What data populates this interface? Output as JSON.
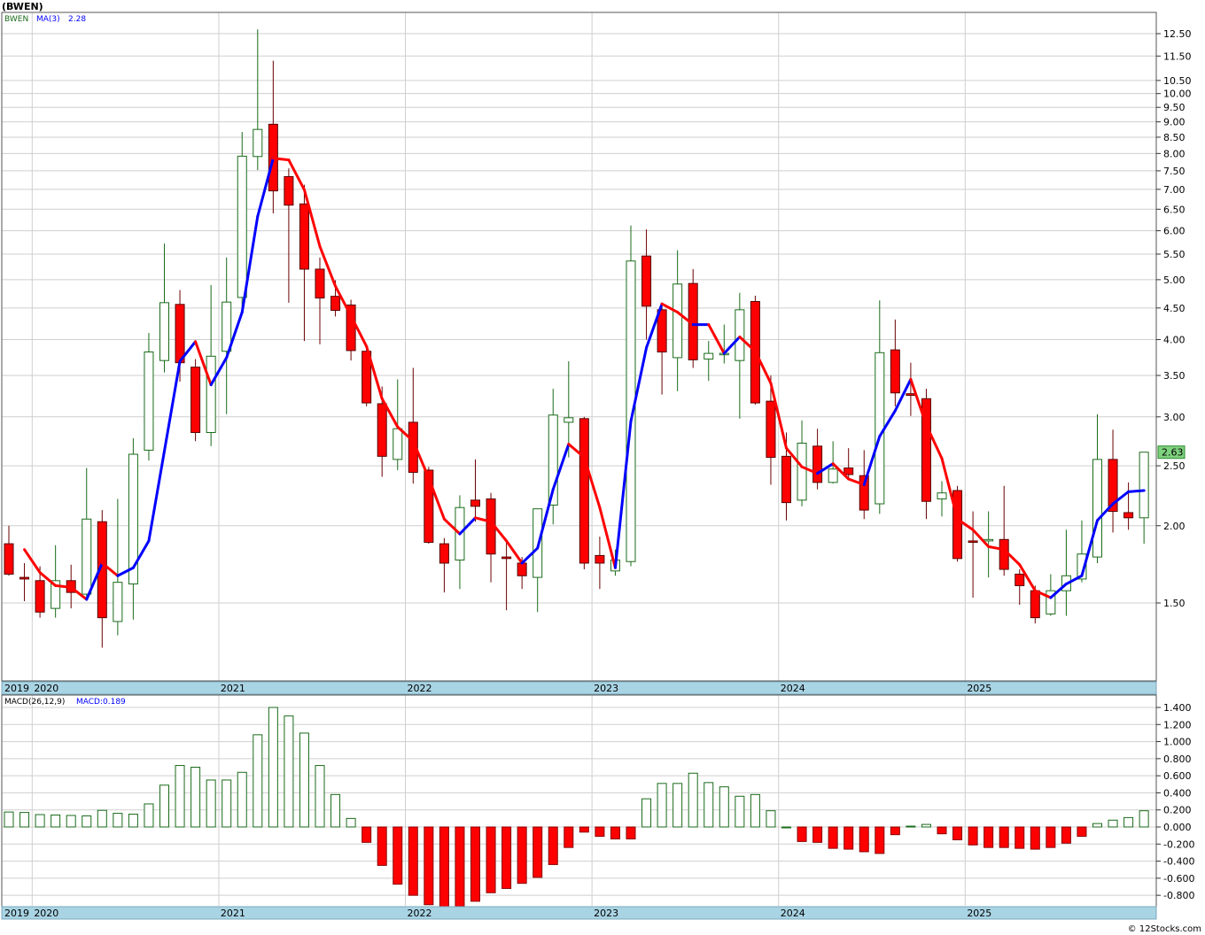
{
  "header": {
    "title": "(BWEN)",
    "watermark": "© 12Stocks.com"
  },
  "price_legend": {
    "symbol": "BWEN",
    "ma_label": "MA(3)",
    "ma_value": "2.28",
    "last_price": "2.63"
  },
  "macd_legend": {
    "label": "MACD(26,12,9)",
    "value": "MACD:0.189"
  },
  "colors": {
    "up": "#1a6b1a",
    "down": "#ff0000",
    "ma_up": "#0000ff",
    "ma_down": "#ff0000",
    "grid": "#cfcfcf",
    "axis_band": "#a9d4e4",
    "last_badge": "#7ed27e"
  },
  "chart_data": [
    {
      "type": "candlestick",
      "scale": "log",
      "interval": "monthly",
      "title": "(BWEN)",
      "x_labels": [
        "2019",
        "2020",
        "2021",
        "2022",
        "2023",
        "2024",
        "2025"
      ],
      "y_ticks": [
        "12.50",
        "11.50",
        "10.50",
        "10.00",
        "9.50",
        "9.00",
        "8.50",
        "8.00",
        "7.50",
        "7.00",
        "6.50",
        "6.00",
        "5.50",
        "5.00",
        "4.50",
        "4.00",
        "3.50",
        "3.00",
        "2.50",
        "2.00",
        "1.50"
      ],
      "grid": true,
      "candles": [
        {
          "d": "2019-11",
          "o": 1.87,
          "h": 2.0,
          "l": 1.66,
          "c": 1.67
        },
        {
          "d": "2019-12",
          "o": 1.65,
          "h": 1.74,
          "l": 1.51,
          "c": 1.64
        },
        {
          "d": "2020-01",
          "o": 1.63,
          "h": 1.72,
          "l": 1.42,
          "c": 1.45
        },
        {
          "d": "2020-02",
          "o": 1.47,
          "h": 1.86,
          "l": 1.42,
          "c": 1.63
        },
        {
          "d": "2020-03",
          "o": 1.63,
          "h": 1.73,
          "l": 1.47,
          "c": 1.56
        },
        {
          "d": "2020-04",
          "o": 1.55,
          "h": 2.48,
          "l": 1.52,
          "c": 2.05
        },
        {
          "d": "2020-05",
          "o": 2.03,
          "h": 2.12,
          "l": 1.27,
          "c": 1.42
        },
        {
          "d": "2020-06",
          "o": 1.4,
          "h": 2.21,
          "l": 1.33,
          "c": 1.62
        },
        {
          "d": "2020-07",
          "o": 1.61,
          "h": 2.77,
          "l": 1.41,
          "c": 2.61
        },
        {
          "d": "2020-08",
          "o": 2.65,
          "h": 4.1,
          "l": 2.55,
          "c": 3.82
        },
        {
          "d": "2020-09",
          "o": 3.7,
          "h": 5.72,
          "l": 3.54,
          "c": 4.59
        },
        {
          "d": "2020-10",
          "o": 4.56,
          "h": 4.81,
          "l": 3.42,
          "c": 3.67
        },
        {
          "d": "2020-11",
          "o": 3.61,
          "h": 3.72,
          "l": 2.74,
          "c": 2.83
        },
        {
          "d": "2020-12",
          "o": 2.83,
          "h": 4.9,
          "l": 2.69,
          "c": 3.76
        },
        {
          "d": "2021-01",
          "o": 3.83,
          "h": 5.43,
          "l": 3.03,
          "c": 4.6
        },
        {
          "d": "2021-02",
          "o": 4.68,
          "h": 8.67,
          "l": 4.43,
          "c": 7.92
        },
        {
          "d": "2021-03",
          "o": 7.91,
          "h": 12.7,
          "l": 7.52,
          "c": 8.75
        },
        {
          "d": "2021-04",
          "o": 8.92,
          "h": 11.3,
          "l": 6.4,
          "c": 6.96
        },
        {
          "d": "2021-05",
          "o": 7.34,
          "h": 7.57,
          "l": 4.59,
          "c": 6.6
        },
        {
          "d": "2021-06",
          "o": 6.63,
          "h": 7.12,
          "l": 3.98,
          "c": 5.2
        },
        {
          "d": "2021-07",
          "o": 5.2,
          "h": 5.43,
          "l": 3.93,
          "c": 4.67
        },
        {
          "d": "2021-08",
          "o": 4.7,
          "h": 4.99,
          "l": 4.36,
          "c": 4.46
        },
        {
          "d": "2021-09",
          "o": 4.55,
          "h": 4.64,
          "l": 3.7,
          "c": 3.84
        },
        {
          "d": "2021-10",
          "o": 3.83,
          "h": 3.89,
          "l": 3.12,
          "c": 3.16
        },
        {
          "d": "2021-11",
          "o": 3.15,
          "h": 3.36,
          "l": 2.4,
          "c": 2.59
        },
        {
          "d": "2021-12",
          "o": 2.56,
          "h": 3.45,
          "l": 2.46,
          "c": 2.87
        },
        {
          "d": "2022-01",
          "o": 2.94,
          "h": 3.6,
          "l": 2.34,
          "c": 2.44
        },
        {
          "d": "2022-02",
          "o": 2.46,
          "h": 2.49,
          "l": 1.87,
          "c": 1.88
        },
        {
          "d": "2022-03",
          "o": 1.87,
          "h": 1.91,
          "l": 1.56,
          "c": 1.74
        },
        {
          "d": "2022-04",
          "o": 1.76,
          "h": 2.24,
          "l": 1.58,
          "c": 2.14
        },
        {
          "d": "2022-05",
          "o": 2.2,
          "h": 2.56,
          "l": 2.03,
          "c": 2.15
        },
        {
          "d": "2022-06",
          "o": 2.21,
          "h": 2.26,
          "l": 1.62,
          "c": 1.8
        },
        {
          "d": "2022-07",
          "o": 1.78,
          "h": 1.88,
          "l": 1.46,
          "c": 1.77
        },
        {
          "d": "2022-08",
          "o": 1.74,
          "h": 1.78,
          "l": 1.58,
          "c": 1.66
        },
        {
          "d": "2022-09",
          "o": 1.65,
          "h": 2.11,
          "l": 1.45,
          "c": 2.13
        },
        {
          "d": "2022-10",
          "o": 2.16,
          "h": 3.33,
          "l": 2.01,
          "c": 3.02
        },
        {
          "d": "2022-11",
          "o": 2.94,
          "h": 3.69,
          "l": 2.58,
          "c": 2.99
        },
        {
          "d": "2022-12",
          "o": 2.98,
          "h": 3.0,
          "l": 1.7,
          "c": 1.74
        },
        {
          "d": "2023-01",
          "o": 1.79,
          "h": 1.92,
          "l": 1.58,
          "c": 1.74
        },
        {
          "d": "2023-02",
          "o": 1.69,
          "h": 1.83,
          "l": 1.66,
          "c": 1.76
        },
        {
          "d": "2023-03",
          "o": 1.75,
          "h": 6.12,
          "l": 1.72,
          "c": 5.36
        },
        {
          "d": "2023-04",
          "o": 5.46,
          "h": 6.03,
          "l": 4.0,
          "c": 4.53
        },
        {
          "d": "2023-05",
          "o": 4.47,
          "h": 4.55,
          "l": 3.26,
          "c": 3.82
        },
        {
          "d": "2023-06",
          "o": 3.74,
          "h": 5.58,
          "l": 3.3,
          "c": 4.92
        },
        {
          "d": "2023-07",
          "o": 4.93,
          "h": 5.2,
          "l": 3.6,
          "c": 3.71
        },
        {
          "d": "2023-08",
          "o": 3.72,
          "h": 3.98,
          "l": 3.43,
          "c": 3.8
        },
        {
          "d": "2023-09",
          "o": 3.78,
          "h": 4.23,
          "l": 3.66,
          "c": 3.8
        },
        {
          "d": "2023-10",
          "o": 3.7,
          "h": 4.76,
          "l": 2.98,
          "c": 4.47
        },
        {
          "d": "2023-11",
          "o": 4.61,
          "h": 4.71,
          "l": 3.14,
          "c": 3.16
        },
        {
          "d": "2023-12",
          "o": 3.18,
          "h": 3.5,
          "l": 2.33,
          "c": 2.58
        },
        {
          "d": "2024-01",
          "o": 2.59,
          "h": 2.83,
          "l": 2.04,
          "c": 2.18
        },
        {
          "d": "2024-02",
          "o": 2.2,
          "h": 2.96,
          "l": 2.15,
          "c": 2.72
        },
        {
          "d": "2024-03",
          "o": 2.69,
          "h": 2.87,
          "l": 2.29,
          "c": 2.35
        },
        {
          "d": "2024-04",
          "o": 2.35,
          "h": 2.74,
          "l": 2.34,
          "c": 2.47
        },
        {
          "d": "2024-05",
          "o": 2.48,
          "h": 2.67,
          "l": 2.37,
          "c": 2.42
        },
        {
          "d": "2024-06",
          "o": 2.41,
          "h": 2.65,
          "l": 2.05,
          "c": 2.12
        },
        {
          "d": "2024-07",
          "o": 2.17,
          "h": 4.63,
          "l": 2.09,
          "c": 3.81
        },
        {
          "d": "2024-08",
          "o": 3.85,
          "h": 4.31,
          "l": 3.12,
          "c": 3.28
        },
        {
          "d": "2024-09",
          "o": 3.27,
          "h": 3.67,
          "l": 3.01,
          "c": 3.25
        },
        {
          "d": "2024-10",
          "o": 3.21,
          "h": 3.33,
          "l": 2.05,
          "c": 2.19
        },
        {
          "d": "2024-11",
          "o": 2.21,
          "h": 2.36,
          "l": 2.07,
          "c": 2.26
        },
        {
          "d": "2024-12",
          "o": 2.28,
          "h": 2.32,
          "l": 1.75,
          "c": 1.77
        },
        {
          "d": "2025-01",
          "o": 1.89,
          "h": 2.11,
          "l": 1.53,
          "c": 1.88
        },
        {
          "d": "2025-02",
          "o": 1.89,
          "h": 2.11,
          "l": 1.65,
          "c": 1.9
        },
        {
          "d": "2025-03",
          "o": 1.9,
          "h": 2.32,
          "l": 1.66,
          "c": 1.7
        },
        {
          "d": "2025-04",
          "o": 1.67,
          "h": 1.7,
          "l": 1.49,
          "c": 1.6
        },
        {
          "d": "2025-05",
          "o": 1.57,
          "h": 1.6,
          "l": 1.39,
          "c": 1.42
        },
        {
          "d": "2025-06",
          "o": 1.44,
          "h": 1.67,
          "l": 1.43,
          "c": 1.57
        },
        {
          "d": "2025-07",
          "o": 1.57,
          "h": 1.97,
          "l": 1.43,
          "c": 1.66
        },
        {
          "d": "2025-08",
          "o": 1.64,
          "h": 2.04,
          "l": 1.62,
          "c": 1.8
        },
        {
          "d": "2025-09",
          "o": 1.78,
          "h": 3.03,
          "l": 1.74,
          "c": 2.56
        },
        {
          "d": "2025-10",
          "o": 2.56,
          "h": 2.86,
          "l": 1.95,
          "c": 2.11
        },
        {
          "d": "2025-11",
          "o": 2.1,
          "h": 2.35,
          "l": 1.97,
          "c": 2.06
        },
        {
          "d": "2025-12",
          "o": 2.06,
          "h": 2.63,
          "l": 1.87,
          "c": 2.63
        }
      ],
      "series": [
        {
          "name": "MA(3)",
          "values": [
            null,
            1.83,
            1.68,
            1.6,
            1.59,
            1.52,
            1.74,
            1.66,
            1.71,
            1.89,
            2.64,
            3.69,
            3.97,
            3.38,
            3.74,
            4.43,
            6.33,
            7.86,
            7.81,
            6.99,
            5.66,
            4.88,
            4.37,
            3.9,
            3.21,
            2.89,
            2.74,
            2.39,
            2.05,
            1.94,
            2.06,
            2.03,
            1.89,
            1.74,
            1.84,
            2.29,
            2.71,
            2.58,
            2.14,
            1.71,
            2.95,
            3.88,
            4.57,
            4.43,
            4.23,
            4.23,
            3.8,
            4.04,
            3.83,
            3.4,
            2.67,
            2.49,
            2.43,
            2.52,
            2.38,
            2.33,
            2.79,
            3.07,
            3.45,
            2.91,
            2.57,
            2.05,
            1.97,
            1.85,
            1.83,
            1.73,
            1.57,
            1.53,
            1.61,
            1.66,
            2.04,
            2.17,
            2.27,
            2.28
          ]
        }
      ]
    },
    {
      "type": "bar",
      "title": "MACD(26,12,9)",
      "x_labels": [
        "2019",
        "2020",
        "2021",
        "2022",
        "2023",
        "2024",
        "2025"
      ],
      "y_ticks": [
        "1.400",
        "1.200",
        "1.000",
        "0.800",
        "0.600",
        "0.400",
        "0.200",
        "0.000",
        "-0.200",
        "-0.400",
        "-0.600",
        "-0.800"
      ],
      "ylim": [
        -0.93,
        1.45
      ],
      "grid": true,
      "series": [
        {
          "name": "MACD",
          "values": [
            0.175,
            0.17,
            0.145,
            0.14,
            0.135,
            0.13,
            0.195,
            0.16,
            0.15,
            0.27,
            0.49,
            0.72,
            0.7,
            0.55,
            0.55,
            0.64,
            1.08,
            1.4,
            1.3,
            1.1,
            0.72,
            0.38,
            0.1,
            -0.18,
            -0.45,
            -0.67,
            -0.8,
            -0.91,
            -0.96,
            -0.93,
            -0.87,
            -0.77,
            -0.72,
            -0.66,
            -0.59,
            -0.44,
            -0.24,
            -0.06,
            -0.11,
            -0.14,
            -0.14,
            0.33,
            0.51,
            0.51,
            0.63,
            0.52,
            0.47,
            0.36,
            0.38,
            0.19,
            0.0,
            -0.17,
            -0.18,
            -0.25,
            -0.26,
            -0.29,
            -0.31,
            -0.09,
            0.01,
            0.03,
            -0.08,
            -0.15,
            -0.21,
            -0.24,
            -0.24,
            -0.25,
            -0.26,
            -0.24,
            -0.19,
            -0.11,
            0.04,
            0.08,
            0.11,
            0.19
          ]
        }
      ]
    }
  ]
}
